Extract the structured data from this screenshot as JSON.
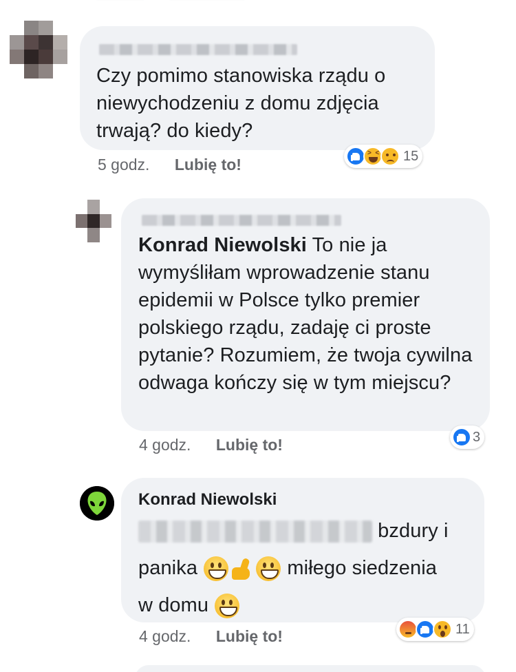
{
  "comments": [
    {
      "text": "Czy pomimo stanowiska rządu o niewychodzeniu z domu zdjęcia trwają? do kiedy?",
      "time": "5 godz.",
      "like_label": "Lubię to!",
      "reactions": [
        "like-reaction-icon",
        "haha-reaction-icon",
        "sad-reaction-icon"
      ],
      "reaction_count": "15"
    },
    {
      "mention": "Konrad Niewolski",
      "text": "To nie ja wymyśliłam wprowadzenie stanu epidemii w Polsce tylko premier polskiego rządu, zadaję ci proste pytanie? Rozumiem, że twoja cywilna odwaga kończy się w tym miejscu?",
      "time": "4 godz.",
      "like_label": "Lubię to!",
      "reactions": [
        "like-reaction-icon"
      ],
      "reaction_count": "3"
    },
    {
      "author": "Konrad Niewolski",
      "text_1": "bzdury i",
      "text_2": "panika",
      "text_3": "miłego siedzenia",
      "text_4": "w domu",
      "emojis": [
        "grinning-emoji",
        "thumbs-up-emoji",
        "grinning-emoji",
        "grinning-emoji"
      ],
      "time": "4 godz.",
      "like_label": "Lubię to!",
      "reactions": [
        "angry-reaction-icon",
        "like-reaction-icon",
        "wow-reaction-icon"
      ],
      "reaction_count": "11"
    }
  ],
  "colors": {
    "bubble": "#f0f2f5",
    "meta_text": "#65676b",
    "like_blue": "#1877f2",
    "emoji_yellow": "#f7b928"
  }
}
